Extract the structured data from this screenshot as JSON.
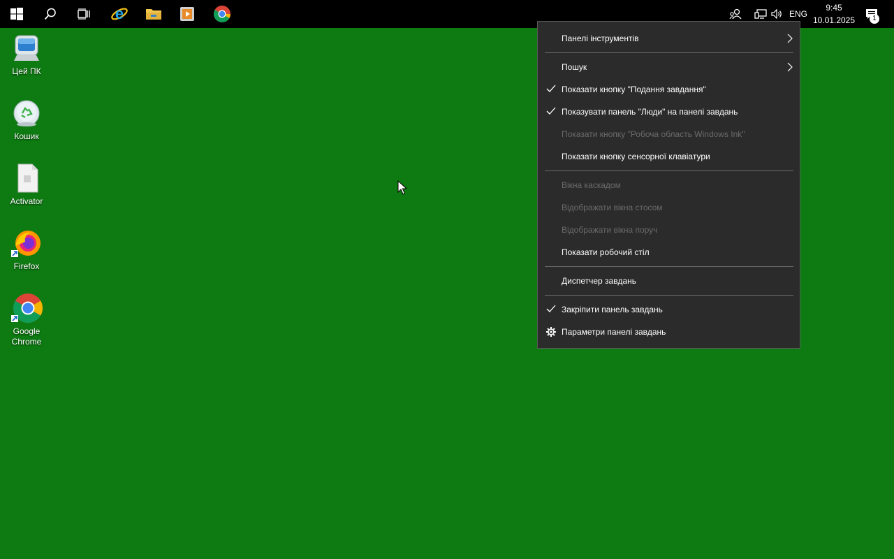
{
  "taskbar": {
    "start_icon": "windows-logo-icon",
    "pinned": [
      {
        "name": "search",
        "icon": "search-icon"
      },
      {
        "name": "task-view",
        "icon": "task-view-icon"
      },
      {
        "name": "internet-explorer",
        "icon": "ie-icon"
      },
      {
        "name": "file-explorer",
        "icon": "folder-icon"
      },
      {
        "name": "media-player",
        "icon": "media-icon"
      },
      {
        "name": "chrome",
        "icon": "chrome-icon"
      }
    ],
    "tray": {
      "language": "ENG",
      "time": "9:45",
      "date": "10.01.2025",
      "notification_count": "1"
    }
  },
  "desktop": {
    "icons": [
      {
        "label": "Цей ПК",
        "icon": "computer-icon"
      },
      {
        "label": "Кошик",
        "icon": "recycle-bin-icon"
      },
      {
        "label": "Activator",
        "icon": "file-icon"
      },
      {
        "label": "Firefox",
        "icon": "firefox-icon"
      },
      {
        "label": "Google Chrome",
        "icon": "chrome-icon"
      }
    ]
  },
  "context_menu": {
    "items": [
      {
        "label": "Панелі інструментів",
        "submenu": true
      },
      {
        "label": "Пошук",
        "submenu": true
      },
      {
        "label": "Показати кнопку \"Подання завдання\"",
        "checked": true
      },
      {
        "label": "Показувати панель \"Люди\" на панелі завдань",
        "checked": true
      },
      {
        "label": "Показати кнопку \"Робоча область Windows Ink\"",
        "disabled": true
      },
      {
        "label": "Показати кнопку сенсорної клавіатури"
      },
      {
        "label": "Вікна каскадом",
        "disabled": true
      },
      {
        "label": "Відображати вікна стосом",
        "disabled": true
      },
      {
        "label": "Відображати вікна поруч",
        "disabled": true
      },
      {
        "label": "Показати робочий стіл"
      },
      {
        "label": "Диспетчер завдань"
      },
      {
        "label": "Закріпити панель завдань",
        "checked": true
      },
      {
        "label": "Параметри панелі завдань",
        "icon": "gear-icon"
      }
    ]
  },
  "colors": {
    "desktop_bg": "#0e7b12",
    "taskbar_bg": "#000000",
    "menu_bg": "#2b2b2b",
    "menu_disabled_text": "#6b6b6b"
  }
}
